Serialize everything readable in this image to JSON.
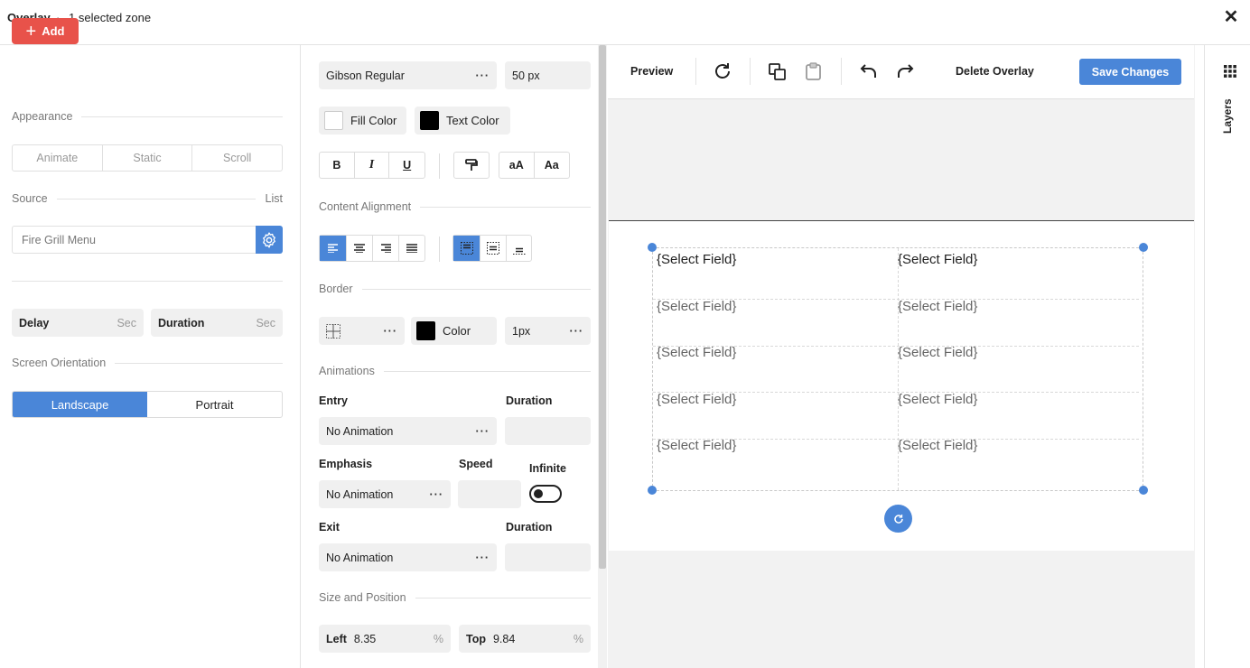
{
  "header": {
    "title": "Overlay",
    "separator": "·",
    "subtitle": "1 selected zone"
  },
  "left": {
    "add_label": "Add",
    "appearance_label": "Appearance",
    "appearance_options": [
      "Animate",
      "Static",
      "Scroll"
    ],
    "source_label": "Source",
    "source_right": "List",
    "source_value": "Fire Grill Menu",
    "delay_label": "Delay",
    "delay_unit": "Sec",
    "duration_label": "Duration",
    "duration_unit": "Sec",
    "orientation_label": "Screen Orientation",
    "orientation_options": [
      "Landscape",
      "Portrait"
    ],
    "orientation_selected": "Landscape"
  },
  "mid": {
    "font": "Gibson Regular",
    "font_size": "50 px",
    "fill_color_label": "Fill Color",
    "text_color_label": "Text Color",
    "bold": "B",
    "italic": "I",
    "underline": "U",
    "case_lower": "aA",
    "case_title": "Aa",
    "alignment_label": "Content Alignment",
    "border_label": "Border",
    "border_color_label": "Color",
    "border_width": "1px",
    "animations_label": "Animations",
    "entry_label": "Entry",
    "entry_duration_label": "Duration",
    "entry_value": "No Animation",
    "emphasis_label": "Emphasis",
    "speed_label": "Speed",
    "infinite_label": "Infinite",
    "emphasis_value": "No Animation",
    "exit_label": "Exit",
    "exit_duration_label": "Duration",
    "exit_value": "No Animation",
    "size_position_label": "Size and Position",
    "left_label": "Left",
    "left_value": "8.35",
    "left_unit": "%",
    "top_label": "Top",
    "top_value": "9.84",
    "top_unit": "%"
  },
  "toolbar": {
    "preview_label": "Preview",
    "delete_label": "Delete Overlay",
    "save_label": "Save Changes"
  },
  "canvas": {
    "cells": [
      [
        "{Select Field}",
        "{Select Field}"
      ],
      [
        "{Select Field}",
        "{Select Field}"
      ],
      [
        "{Select Field}",
        "{Select Field}"
      ],
      [
        "{Select Field}",
        "{Select Field}"
      ],
      [
        "{Select Field}",
        "{Select Field}"
      ]
    ]
  },
  "rail": {
    "layers_label": "Layers"
  },
  "colors": {
    "accent": "#4a86d8",
    "add": "#e8524a"
  }
}
